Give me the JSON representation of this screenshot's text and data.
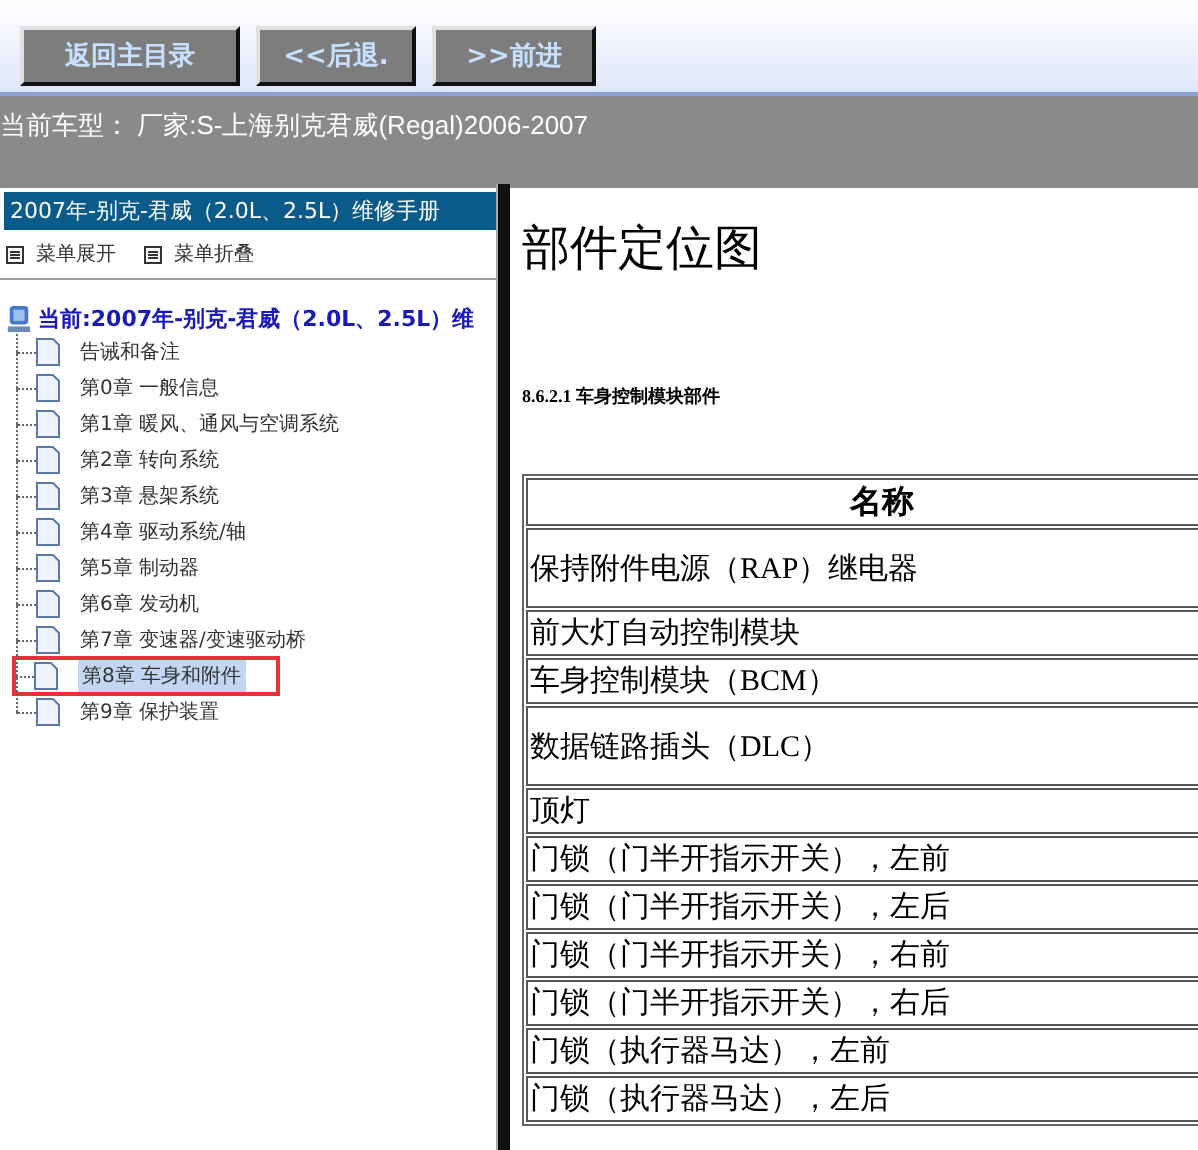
{
  "toolbar": {
    "buttons": [
      "返回主目录",
      "<<后退.",
      ">>前进"
    ]
  },
  "current_model": "当前车型： 厂家:S-上海别克君威(Regal)2006-2007",
  "sidebar": {
    "title": "2007年-别克-君威（2.0L、2.5L）维修手册",
    "actions": [
      "菜单展开",
      "菜单折叠"
    ],
    "tree": {
      "label": "当前:2007年-别克-君威（2.0L、2.5L）维",
      "children": [
        {
          "label": "告诫和备注",
          "selected": false
        },
        {
          "label": "第0章 一般信息",
          "selected": false
        },
        {
          "label": "第1章 暖风、通风与空调系统",
          "selected": false
        },
        {
          "label": "第2章 转向系统",
          "selected": false
        },
        {
          "label": "第3章 悬架系统",
          "selected": false
        },
        {
          "label": "第4章 驱动系统/轴",
          "selected": false
        },
        {
          "label": "第5章 制动器",
          "selected": false
        },
        {
          "label": "第6章 发动机",
          "selected": false
        },
        {
          "label": "第7章 变速器/变速驱动桥",
          "selected": false
        },
        {
          "label": "第8章 车身和附件",
          "selected": true
        },
        {
          "label": "第9章 保护装置",
          "selected": false
        }
      ]
    }
  },
  "content": {
    "title": "部件定位图",
    "section": "8.6.2.1 车身控制模块部件",
    "table": {
      "columns": [
        "名称"
      ],
      "rows": [
        {
          "name": "保持附件电源（RAP）继电器",
          "kind": "tall"
        },
        {
          "name": "前大灯自动控制模块",
          "kind": "normal"
        },
        {
          "name": "车身控制模块（BCM）",
          "kind": "normal"
        },
        {
          "name": "数据链路插头（DLC）",
          "kind": "tall"
        },
        {
          "name": "顶灯",
          "kind": "normal"
        },
        {
          "name": "门锁（门半开指示开关），左前",
          "kind": "normal"
        },
        {
          "name": "门锁（门半开指示开关），左后",
          "kind": "normal"
        },
        {
          "name": "门锁（门半开指示开关），右前",
          "kind": "normal"
        },
        {
          "name": "门锁（门半开指示开关），右后",
          "kind": "normal"
        },
        {
          "name": "门锁（执行器马达），左前",
          "kind": "normal"
        },
        {
          "name": "门锁（执行器马达），左后",
          "kind": "normal"
        }
      ]
    }
  }
}
